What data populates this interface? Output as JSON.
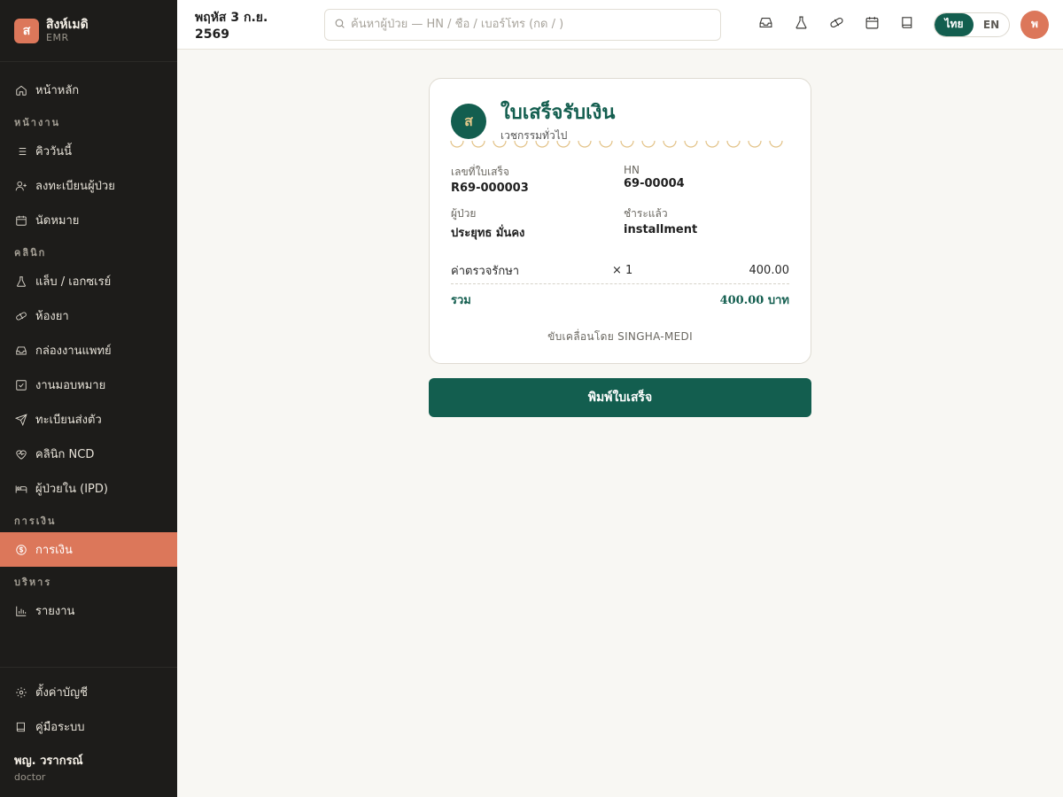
{
  "brand": {
    "logo_letter": "ส",
    "name": "สิงห์เมดิ",
    "sub": "EMR"
  },
  "sidebar": {
    "home": "หน้าหลัก",
    "sections": {
      "work": "หน้างาน",
      "clinic": "คลินิก",
      "finance": "การเงิน",
      "admin": "บริหาร"
    },
    "items": {
      "queue": "คิววันนี้",
      "register": "ลงทะเบียนผู้ป่วย",
      "appointments": "นัดหมาย",
      "lab": "แล็บ / เอกซเรย์",
      "pharmacy": "ห้องยา",
      "inbox": "กล่องงานแพทย์",
      "tasks": "งานมอบหมาย",
      "referral": "ทะเบียนส่งตัว",
      "ncd": "คลินิก NCD",
      "ipd": "ผู้ป่วยใน (IPD)",
      "billing": "การเงิน",
      "reports": "รายงาน"
    },
    "bottom": {
      "settings": "ตั้งค่าบัญชี",
      "manual": "คู่มือระบบ"
    },
    "user": {
      "name": "พญ. วรากรณ์",
      "role": "doctor"
    }
  },
  "topbar": {
    "date": "พฤหัส 3 ก.ย. 2569",
    "search_placeholder": "ค้นหาผู้ป่วย — HN / ชื่อ / เบอร์โทร (กด / )",
    "lang_th": "ไทย",
    "lang_en": "EN",
    "avatar_letter": "พ"
  },
  "receipt": {
    "logo_letter": "ส",
    "title": "ใบเสร็จรับเงิน",
    "subtitle": "เวชกรรมทั่วไป",
    "receipt_no_label": "เลขที่ใบเสร็จ",
    "receipt_no": "R69-000003",
    "hn_label": "HN",
    "hn": "69-00004",
    "patient_label": "ผู้ป่วย",
    "patient": "ประยุทธ มั่นคง",
    "paid_label": "ชำระแล้ว",
    "paid": "installment",
    "items": [
      {
        "desc": "ค่าตรวจรักษา",
        "qty": "× 1",
        "amount": "400.00"
      }
    ],
    "total_label": "รวม",
    "total": "400.00 บาท",
    "powered_by": "ขับเคลื่อนโดย SINGHA-MEDI"
  },
  "actions": {
    "print": "พิมพ์ใบเสร็จ"
  },
  "colors": {
    "accent": "#dc775a",
    "primary": "#135e4f",
    "sidebar_bg": "#1d1c1a"
  }
}
